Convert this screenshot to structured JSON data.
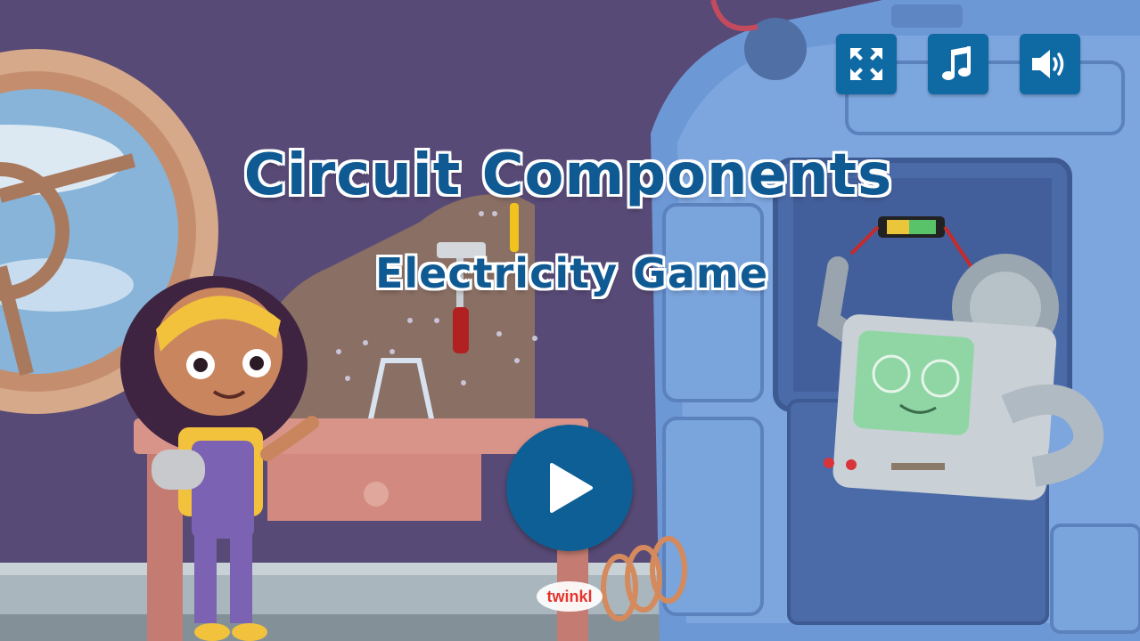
{
  "game": {
    "title": "Circuit Components",
    "subtitle": "Electricity Game"
  },
  "controls": [
    {
      "name": "fullscreen",
      "icon": "fullscreen-icon"
    },
    {
      "name": "music",
      "icon": "music-note-icon"
    },
    {
      "name": "sound",
      "icon": "speaker-volume-icon"
    }
  ],
  "play_button": {
    "icon": "play-icon"
  },
  "brand": {
    "logo_text": "twinkl"
  },
  "colors": {
    "title_blue": "#0f5a93",
    "button_blue": "#0f6aa4",
    "wall_purple": "#5b4d78",
    "machine_blue": "#6d98d6",
    "screen_green": "#8fd6a4"
  }
}
